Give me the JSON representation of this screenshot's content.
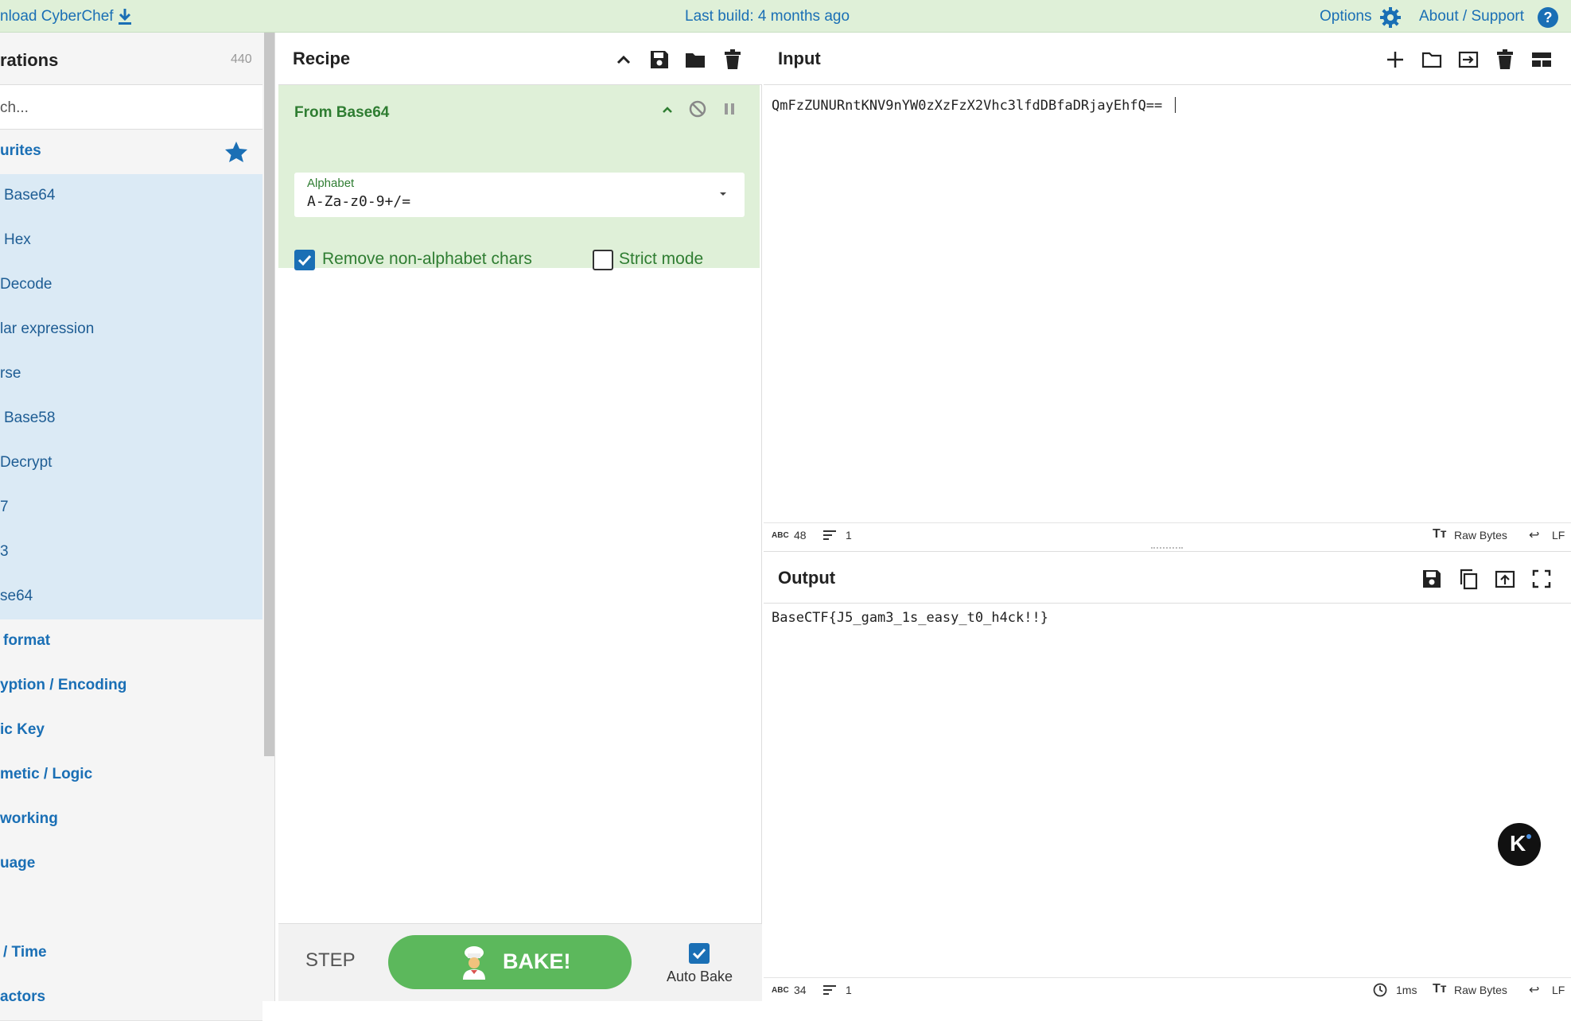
{
  "banner": {
    "download_label": "nload CyberChef",
    "build_label": "Last build: 4 months ago",
    "options_label": "Options",
    "about_label": "About / Support"
  },
  "operations": {
    "title": "rations",
    "count": "440",
    "search_placeholder": "ch...",
    "favourites_label": "urites",
    "favourites": [
      "Base64",
      "Hex",
      "Decode",
      "lar expression",
      "rse",
      "Base58",
      "Decrypt",
      "7",
      "3",
      "se64"
    ],
    "categories": [
      "format",
      "yption / Encoding",
      "ic Key",
      "metic / Logic",
      "working",
      "uage",
      "",
      "/ Time",
      "actors"
    ]
  },
  "recipe": {
    "title": "Recipe",
    "operation": {
      "name": "From Base64",
      "alphabet_label": "Alphabet",
      "alphabet_value": "A-Za-z0-9+/=",
      "remove_nonalpha_label": "Remove non-alphabet chars",
      "remove_nonalpha_checked": true,
      "strict_mode_label": "Strict mode",
      "strict_mode_checked": false
    },
    "step_label": "STEP",
    "bake_label": "BAKE!",
    "autobake_label": "Auto Bake",
    "autobake_checked": true
  },
  "input": {
    "title": "Input",
    "text": "QmFzZUNURntKNV9nYW0zXzFzX2Vhc3lfdDBfaDRjayEhfQ==",
    "status": {
      "length": "48",
      "lines": "1",
      "encoding": "Raw Bytes",
      "eol": "LF"
    }
  },
  "output": {
    "title": "Output",
    "text": "BaseCTF{J5_gam3_1s_easy_t0_h4ck!!}",
    "status": {
      "length": "34",
      "lines": "1",
      "time": "1ms",
      "encoding": "Raw Bytes",
      "eol": "LF"
    }
  },
  "colors": {
    "banner_bg": "#dff0d8",
    "link_blue": "#1a6fb5",
    "favourite_bg": "#dbeaf5",
    "recipe_green": "#dff0d8",
    "bake_green": "#5cb85c"
  },
  "icons": {
    "download": "download-icon",
    "gear": "gear-icon",
    "help": "help-icon",
    "star": "star-icon",
    "chevron_up": "chevron-up-icon",
    "save": "save-icon",
    "folder": "folder-icon",
    "trash": "trash-icon",
    "disable": "disable-icon",
    "pause": "pause-icon",
    "plus": "plus-icon",
    "file_open": "file-open-icon",
    "input_tab": "input-tab-icon",
    "layout": "layout-icon",
    "copy": "copy-icon",
    "replace_input": "replace-input-icon",
    "maximize": "maximize-icon",
    "chef": "chef-icon"
  }
}
